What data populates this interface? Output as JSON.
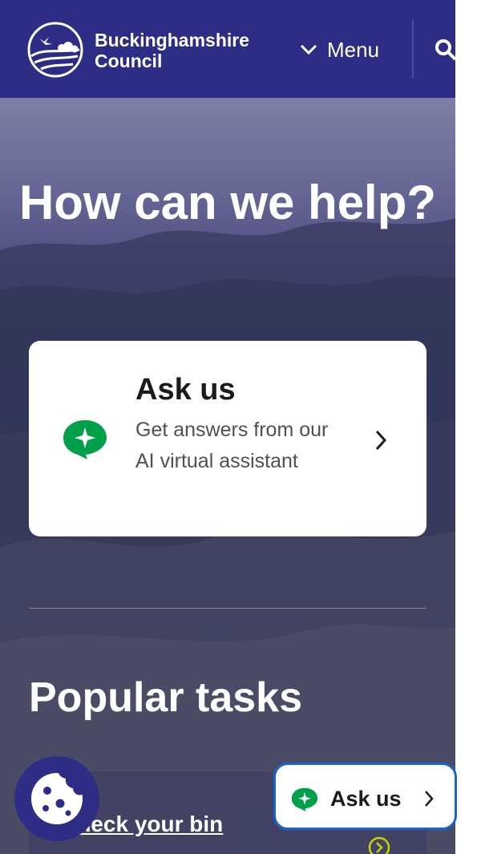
{
  "header": {
    "brand_line1": "Buckinghamshire",
    "brand_line2": "Council",
    "menu_label": "Menu",
    "logo_icon": "council-logo-icon",
    "search_icon": "search-icon"
  },
  "hero": {
    "title": "How can we help?",
    "ask_card": {
      "title": "Ask us",
      "description": "Get answers from our AI virtual assistant",
      "icon": "ai-chat-icon"
    }
  },
  "popular": {
    "heading": "Popular tasks",
    "tasks": [
      {
        "label": "Check your bin"
      }
    ]
  },
  "floating": {
    "ask_label": "Ask us",
    "cookie_icon": "cookie-icon"
  },
  "colors": {
    "header_bg": "#2d2d85",
    "accent_green": "#00a04a",
    "float_border": "#1a65c8"
  }
}
